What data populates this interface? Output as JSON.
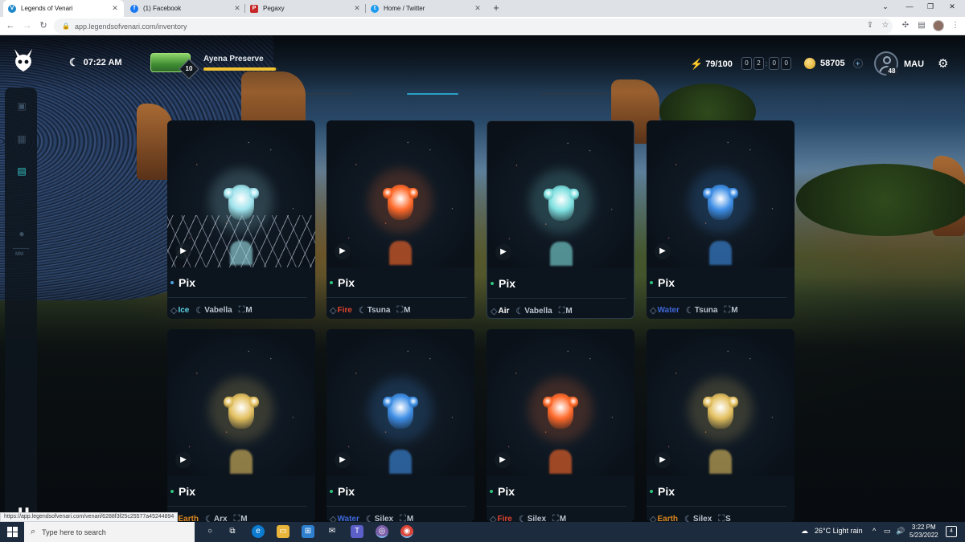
{
  "browser": {
    "tabs": [
      {
        "title": "Legends of Venari",
        "favicon": "venari-favicon",
        "active": true
      },
      {
        "title": "(1) Facebook",
        "favicon": "facebook-favicon",
        "active": false
      },
      {
        "title": "Pegaxy",
        "favicon": "pegaxy-favicon",
        "active": false
      },
      {
        "title": "Home / Twitter",
        "favicon": "twitter-favicon",
        "active": false
      }
    ],
    "url": "app.legendsofvenari.com/inventory",
    "status_url": "https://app.legendsofvenari.com/venari/6288f3f25c25577a45244894"
  },
  "hud": {
    "time": "07:22 AM",
    "location_level": "10",
    "location_name": "Ayena Preserve",
    "location_progress": 0.98,
    "energy": "79/100",
    "timer_digits": [
      "0",
      "2",
      "0",
      "0"
    ],
    "coins": "58705",
    "coin_add": "+",
    "player_level": "48",
    "username": "MAU"
  },
  "cards": [
    {
      "name": "Pix",
      "element": "Ice",
      "element_color": "#5fd3e6",
      "dot_color": "#4aa3df",
      "region": "Vabella",
      "size": "M",
      "hue": "#9fe3ec",
      "shards": true
    },
    {
      "name": "Pix",
      "element": "Fire",
      "element_color": "#e0452f",
      "dot_color": "#2ec27e",
      "region": "Tsuna",
      "size": "M",
      "hue": "#ff6a2a",
      "shards": false
    },
    {
      "name": "Pix",
      "element": "Air",
      "element_color": "#ffffff",
      "dot_color": "#2ec27e",
      "region": "Vabella",
      "size": "M",
      "hue": "#7fe0e0",
      "shards": false,
      "selected": true
    },
    {
      "name": "Pix",
      "element": "Water",
      "element_color": "#3f67d6",
      "dot_color": "#2ec27e",
      "region": "Tsuna",
      "size": "M",
      "hue": "#3f8fe6",
      "shards": false
    },
    {
      "name": "Pix",
      "element": "Earth",
      "element_color": "#d9861f",
      "dot_color": "#2ec27e",
      "region": "Arx",
      "size": "M",
      "hue": "#e3c060",
      "shards": false
    },
    {
      "name": "Pix",
      "element": "Water",
      "element_color": "#3f67d6",
      "dot_color": "#2ec27e",
      "region": "Silex",
      "size": "M",
      "hue": "#3f8fe6",
      "shards": false
    },
    {
      "name": "Pix",
      "element": "Fire",
      "element_color": "#e0452f",
      "dot_color": "#2ec27e",
      "region": "Silex",
      "size": "M",
      "hue": "#ff6a2a",
      "shards": false
    },
    {
      "name": "Pix",
      "element": "Earth",
      "element_color": "#d9861f",
      "dot_color": "#2ec27e",
      "region": "Silex",
      "size": "S",
      "hue": "#e3c060",
      "shards": false
    }
  ],
  "taskbar": {
    "search_placeholder": "Type here to search",
    "weather": "26°C  Light rain",
    "time": "3:22 PM",
    "date": "5/23/2022",
    "notification_count": "4"
  }
}
